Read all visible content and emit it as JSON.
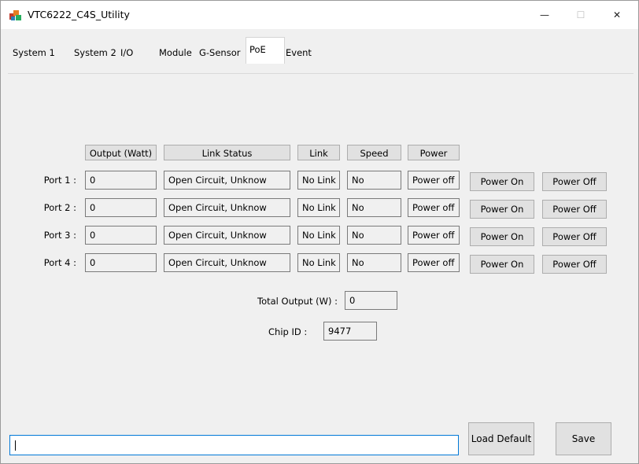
{
  "window": {
    "title": "VTC6222_C4S_Utility",
    "minimize_glyph": "—",
    "maximize_glyph": "☐",
    "close_glyph": "✕"
  },
  "tabs": [
    "System 1",
    "System 2",
    "I/O",
    "Module",
    "G-Sensor",
    "PoE",
    "Event"
  ],
  "active_tab": "PoE",
  "headers": {
    "output": "Output (Watt)",
    "link_status": "Link Status",
    "link": "Link",
    "speed": "Speed",
    "power": "Power"
  },
  "ports": [
    {
      "label": "Port 1 :",
      "output": "0",
      "link_status": "Open Circuit, Unknow",
      "link": "No Link",
      "speed": "No",
      "power": "Power off",
      "on_label": "Power On",
      "off_label": "Power Off"
    },
    {
      "label": "Port 2 :",
      "output": "0",
      "link_status": "Open Circuit, Unknow",
      "link": "No Link",
      "speed": "No",
      "power": "Power off",
      "on_label": "Power On",
      "off_label": "Power Off"
    },
    {
      "label": "Port 3 :",
      "output": "0",
      "link_status": "Open Circuit, Unknow",
      "link": "No Link",
      "speed": "No",
      "power": "Power off",
      "on_label": "Power On",
      "off_label": "Power Off"
    },
    {
      "label": "Port 4 :",
      "output": "0",
      "link_status": "Open Circuit, Unknow",
      "link": "No Link",
      "speed": "No",
      "power": "Power off",
      "on_label": "Power On",
      "off_label": "Power Off"
    }
  ],
  "total_output": {
    "label": "Total Output (W) :",
    "value": "0"
  },
  "chip_id": {
    "label": "Chip ID :",
    "value": "9477"
  },
  "footer": {
    "status_value": "",
    "load_default_label": "Load Default",
    "save_label": "Save"
  },
  "colors": {
    "accent": "#0078d7",
    "window_bg": "#f0f0f0",
    "button_bg": "#e1e1e1"
  }
}
